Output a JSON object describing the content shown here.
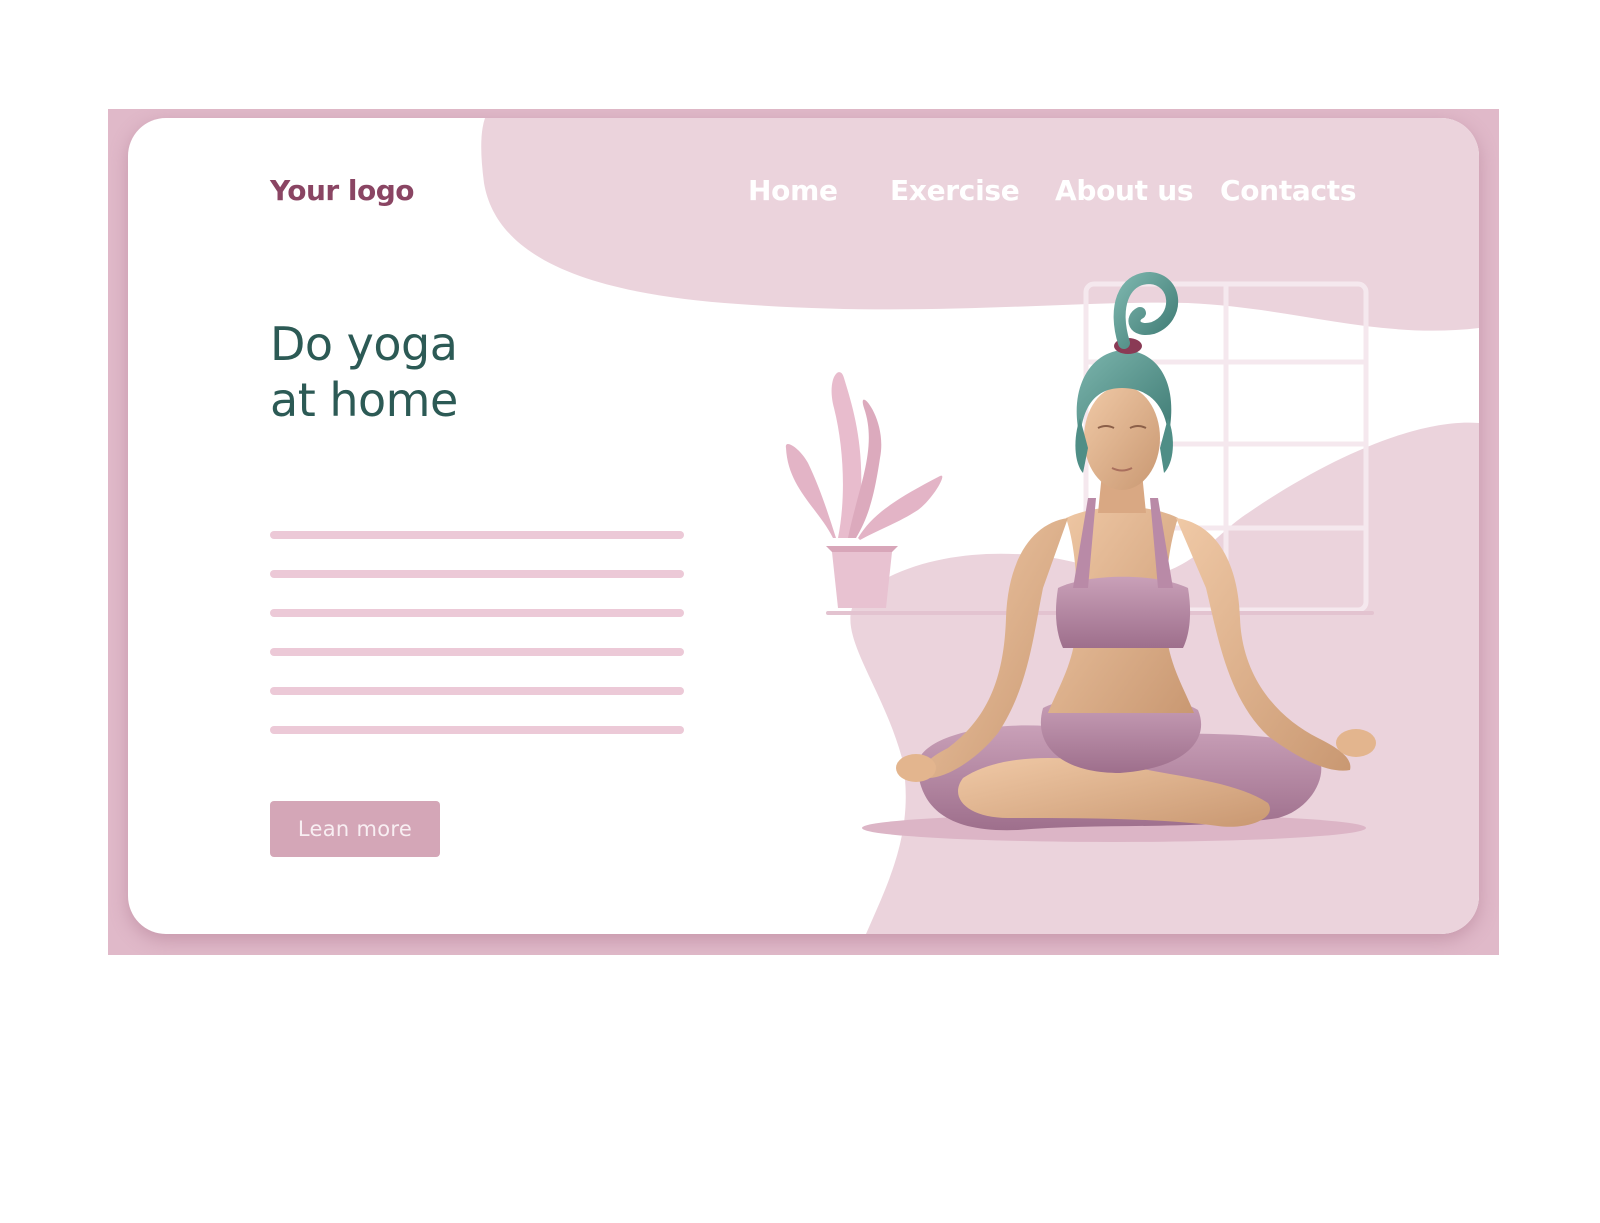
{
  "header": {
    "logo_text": "Your logo",
    "nav": [
      "Home",
      "Exercise",
      "About us",
      "Contacts"
    ]
  },
  "hero": {
    "headline_line1": "Do yoga",
    "headline_line2": "at home",
    "placeholder_text_lines": 6,
    "cta_label": "Lean more"
  },
  "illustration": {
    "subject": "woman meditating in lotus pose",
    "props": [
      "potted-plant",
      "window",
      "shelf",
      "floor-mat"
    ]
  },
  "colors": {
    "page_background": "#ffffff",
    "frame": "#e0b9c9",
    "card": "#ffffff",
    "accent_pink": "#ebd3dc",
    "logo": "#8a4563",
    "headline": "#2c5a55",
    "nav_text": "#ffffff",
    "button": "#d4a6b7",
    "text_line": "#ecc9d7",
    "hair": "#5f9c95",
    "skin": "#e3b58e",
    "outfit": "#b98aa7"
  }
}
